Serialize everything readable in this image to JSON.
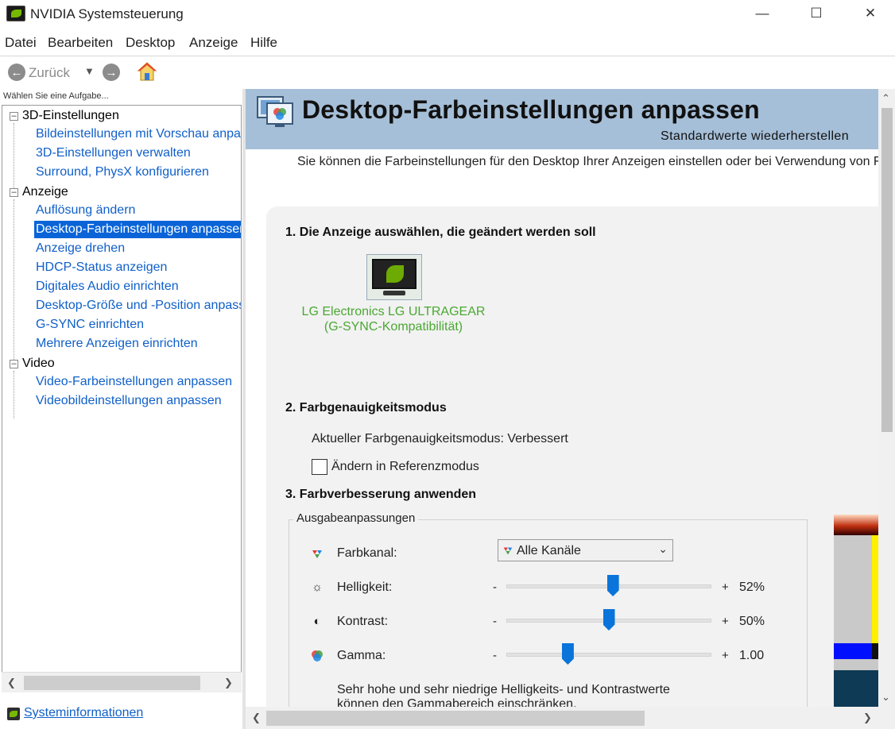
{
  "window": {
    "title": "NVIDIA Systemsteuerung",
    "minimize_icon": "minimize-icon",
    "maximize_icon": "maximize-icon",
    "close_icon": "close-icon"
  },
  "menu": [
    "Datei",
    "Bearbeiten",
    "Desktop",
    "Anzeige",
    "Hilfe"
  ],
  "toolbar": {
    "back_label": "Zurück",
    "back_icon": "arrow-left-icon",
    "dropdown_icon": "caret-down-icon",
    "forward_icon": "arrow-right-icon",
    "home_icon": "home-icon"
  },
  "left_panel": {
    "task_label": "Wählen Sie eine Aufgabe...",
    "tree": [
      {
        "label": "3D-Einstellungen",
        "type": "category",
        "expander": "⊟"
      },
      {
        "label": "Bildeinstellungen mit Vorschau anpassen",
        "type": "link"
      },
      {
        "label": "3D-Einstellungen verwalten",
        "type": "link"
      },
      {
        "label": "Surround, PhysX konfigurieren",
        "type": "link"
      },
      {
        "label": "Anzeige",
        "type": "category",
        "expander": "⊟"
      },
      {
        "label": "Auflösung ändern",
        "type": "link"
      },
      {
        "label": "Desktop-Farbeinstellungen anpassen",
        "type": "link",
        "selected": true
      },
      {
        "label": "Anzeige drehen",
        "type": "link"
      },
      {
        "label": "HDCP-Status anzeigen",
        "type": "link"
      },
      {
        "label": "Digitales Audio einrichten",
        "type": "link"
      },
      {
        "label": "Desktop-Größe und -Position anpassen",
        "type": "link"
      },
      {
        "label": "G-SYNC einrichten",
        "type": "link"
      },
      {
        "label": "Mehrere Anzeigen einrichten",
        "type": "link"
      },
      {
        "label": "Video",
        "type": "category",
        "expander": "⊟"
      },
      {
        "label": "Video-Farbeinstellungen anpassen",
        "type": "link"
      },
      {
        "label": "Videobildeinstellungen anpassen",
        "type": "link"
      }
    ],
    "system_info": "Systeminformationen"
  },
  "main": {
    "title": "Desktop-Farbeinstellungen anpassen",
    "restore_defaults": "Standardwerte wiederherstellen",
    "intro": "Sie können die Farbeinstellungen für den Desktop Ihrer Anzeigen einstellen oder bei Verwendung von F",
    "section1_title": "1. Die Anzeige auswählen, die geändert werden soll",
    "display_name_line1": "LG Electronics LG ULTRAGEAR",
    "display_name_line2": "(G-SYNC-Kompatibilität)",
    "section2_title": "2. Farbgenauigkeitsmodus",
    "current_mode": "Aktueller Farbgenauigkeitsmodus: Verbessert",
    "reference_mode_label": "Ändern in Referenzmodus",
    "reference_mode_checked": false,
    "section3_title": "3. Farbverbesserung anwenden",
    "group_title": "Ausgabeanpassungen",
    "channel_label": "Farbkanal:",
    "channel_value": "Alle Kanäle",
    "sliders": [
      {
        "label": "Helligkeit:",
        "minus": "-",
        "plus": "+",
        "value": "52%",
        "position": 0.52,
        "icon": "sun-icon"
      },
      {
        "label": "Kontrast:",
        "minus": "-",
        "plus": "+",
        "value": "50%",
        "position": 0.5,
        "icon": "contrast-icon"
      },
      {
        "label": "Gamma:",
        "minus": "-",
        "plus": "+",
        "value": "1.00",
        "position": 0.3,
        "icon": "gamma-icon"
      }
    ],
    "hint_line1": "Sehr hohe und sehr niedrige Helligkeits- und Kontrastwerte",
    "hint_line2": "können den Gammabereich einschränken."
  },
  "colors": {
    "header_band": "#a6bfd8",
    "link": "#1060c9",
    "selection": "#0a64d8",
    "display_name": "#4aa832",
    "slider_thumb": "#0a74da",
    "nvidia_green": "#76b900"
  }
}
